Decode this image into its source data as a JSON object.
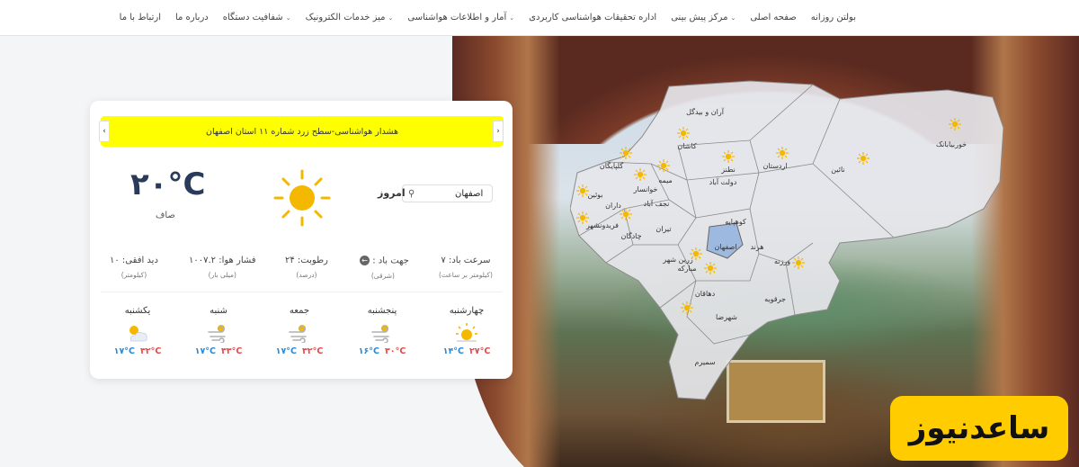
{
  "nav": {
    "items": [
      {
        "label": "بولتن روزانه",
        "chevron": false
      },
      {
        "label": "صفحه اصلی",
        "chevron": false
      },
      {
        "label": "مرکز پیش بینی",
        "chevron": true
      },
      {
        "label": "اداره تحقیقات هواشناسی کاربردی",
        "chevron": false
      },
      {
        "label": "آمار و اطلاعات هواشناسی",
        "chevron": true
      },
      {
        "label": "میز خدمات الکترونیک",
        "chevron": true
      },
      {
        "label": "شفافیت دستگاه",
        "chevron": true
      },
      {
        "label": "درباره ما",
        "chevron": false
      },
      {
        "label": "ارتباط با ما",
        "chevron": false
      }
    ]
  },
  "weather": {
    "alert_text": "هشدار هواشناسی-سطح زرد شماره ۱۱ استان اصفهان",
    "today_label": "امروز",
    "search_value": "اصفهان",
    "temperature": "۲۰°C",
    "condition": "صاف",
    "stats": {
      "wind_speed": {
        "label": "سرعت باد: ۷",
        "unit": "(کیلومتر بر ساعت)"
      },
      "wind_dir": {
        "label": "جهت باد :",
        "unit": "(شرقی)"
      },
      "humidity": {
        "label": "رطوبت: ۲۴",
        "unit": "(درصد)"
      },
      "pressure": {
        "label": "فشار هوا: ۱۰۰۷.۲",
        "unit": "(میلی بار)"
      },
      "visibility": {
        "label": "دید افقی: ۱۰",
        "unit": "(کیلومتر)"
      }
    },
    "forecast": [
      {
        "day": "چهارشنبه",
        "min": "۱۴°C",
        "max": "۲۷°C",
        "icon": "sunny"
      },
      {
        "day": "پنجشنبه",
        "min": "۱۶°C",
        "max": "۳۰°C",
        "icon": "windy"
      },
      {
        "day": "جمعه",
        "min": "۱۷°C",
        "max": "۳۲°C",
        "icon": "windy"
      },
      {
        "day": "شنبه",
        "min": "۱۷°C",
        "max": "۳۳°C",
        "icon": "windy"
      },
      {
        "day": "یکشنبه",
        "min": "۱۷°C",
        "max": "۳۲°C",
        "icon": "partly-cloudy"
      }
    ]
  },
  "map": {
    "cities": [
      {
        "name": "آران و بیدگل"
      },
      {
        "name": "کاشان"
      },
      {
        "name": "نطنز"
      },
      {
        "name": "اردستان"
      },
      {
        "name": "نائین"
      },
      {
        "name": "خوربیابانک"
      },
      {
        "name": "گلپایگان"
      },
      {
        "name": "خوانسار"
      },
      {
        "name": "میمه"
      },
      {
        "name": "بوئین"
      },
      {
        "name": "نجف آباد"
      },
      {
        "name": "داران"
      },
      {
        "name": "دولت آباد"
      },
      {
        "name": "فریدونشهر"
      },
      {
        "name": "چادگان"
      },
      {
        "name": "تیران"
      },
      {
        "name": "کوهپایه"
      },
      {
        "name": "اصفهان"
      },
      {
        "name": "هرند"
      },
      {
        "name": "ورزنه"
      },
      {
        "name": "زرین شهر"
      },
      {
        "name": "مبارکه"
      },
      {
        "name": "دهاقان"
      },
      {
        "name": "شهرضا"
      },
      {
        "name": "جرقویه"
      },
      {
        "name": "سمیرم"
      }
    ]
  },
  "logo": {
    "text": "ساعدنیوز"
  },
  "colors": {
    "alert": "#ffff00",
    "logo": "#ffcc00",
    "min_temp": "#2a8ad4",
    "max_temp": "#e04a4a",
    "map_fill": "#e6e6ea",
    "highlight": "#9db9e0"
  }
}
